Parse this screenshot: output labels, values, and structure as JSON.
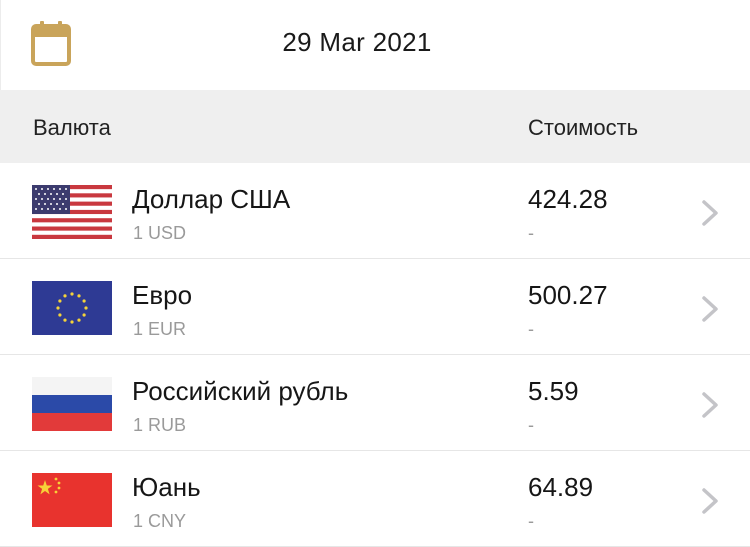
{
  "date_bar": {
    "date": "29 Mar 2021",
    "icon": "calendar-icon"
  },
  "table_header": {
    "currency": "Валюта",
    "value": "Стоимость"
  },
  "rows": [
    {
      "name": "Доллар США",
      "code": "1 USD",
      "value": "424.28",
      "change": "-",
      "flag": "us-flag-icon"
    },
    {
      "name": "Евро",
      "code": "1 EUR",
      "value": "500.27",
      "change": "-",
      "flag": "eu-flag-icon"
    },
    {
      "name": "Российский рубль",
      "code": "1 RUB",
      "value": "5.59",
      "change": "-",
      "flag": "ru-flag-icon"
    },
    {
      "name": "Юань",
      "code": "1 CNY",
      "value": "64.89",
      "change": "-",
      "flag": "cn-flag-icon"
    }
  ],
  "colors": {
    "accent": "#c9a45a",
    "header_bg": "#efefef",
    "muted_text": "#9a9a9a",
    "chevron": "#c4c4c8"
  }
}
